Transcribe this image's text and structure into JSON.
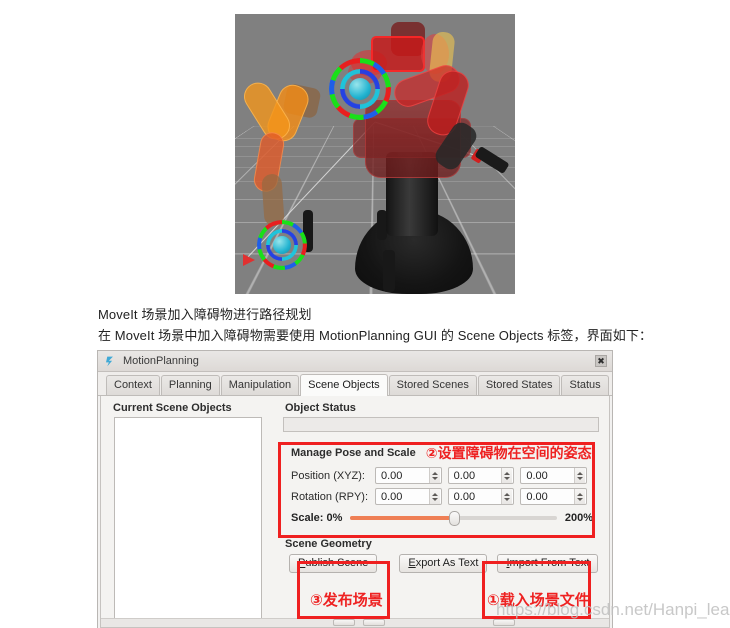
{
  "captions": {
    "line1": "MoveIt 场景加入障碍物进行路径规划",
    "line2": "在 MoveIt 场景中加入障碍物需要使用 MotionPlanning GUI 的 Scene Objects 标签，界面如下："
  },
  "rviz": {
    "alt": "RViz 3D view showing a Baxter robot with MoveIt interactive markers",
    "background_color": "#808080"
  },
  "window": {
    "title": "MotionPlanning",
    "icon": "motion-planning-icon",
    "close_label": "✖"
  },
  "tabs": [
    {
      "label": "Context",
      "active": false
    },
    {
      "label": "Planning",
      "active": false
    },
    {
      "label": "Manipulation",
      "active": false
    },
    {
      "label": "Scene Objects",
      "active": true
    },
    {
      "label": "Stored Scenes",
      "active": false
    },
    {
      "label": "Stored States",
      "active": false
    },
    {
      "label": "Status",
      "active": false
    }
  ],
  "scene_objects": {
    "current_scene_objects_label": "Current Scene Objects",
    "object_list_items": [],
    "object_status_label": "Object Status",
    "object_status_value": "",
    "manage_pose_label": "Manage Pose and Scale",
    "position_label": "Position (XYZ):",
    "position_values": [
      "0.00",
      "0.00",
      "0.00"
    ],
    "rotation_label": "Rotation (RPY):",
    "rotation_values": [
      "0.00",
      "0.00",
      "0.00"
    ],
    "scale_min_label": "Scale: 0%",
    "scale_max_label": "200%",
    "scale_percent": 50,
    "scene_geometry_label": "Scene Geometry",
    "buttons": [
      {
        "name": "publish-scene-button",
        "prefix": "P",
        "rest": "ublish Scene"
      },
      {
        "name": "export-as-text-button",
        "prefix": "E",
        "rest": "xport As Text"
      },
      {
        "name": "import-from-text-button",
        "prefix": "I",
        "rest": "mport From Text"
      }
    ]
  },
  "annotations": {
    "color": "#ee2222",
    "pose_note": "②设置障碍物在空间的姿态",
    "publish_note": "③发布场景",
    "import_note": "①载入场景文件"
  },
  "watermark": {
    "text": "https://blog.csdn.net/Hanpi_learnc"
  }
}
